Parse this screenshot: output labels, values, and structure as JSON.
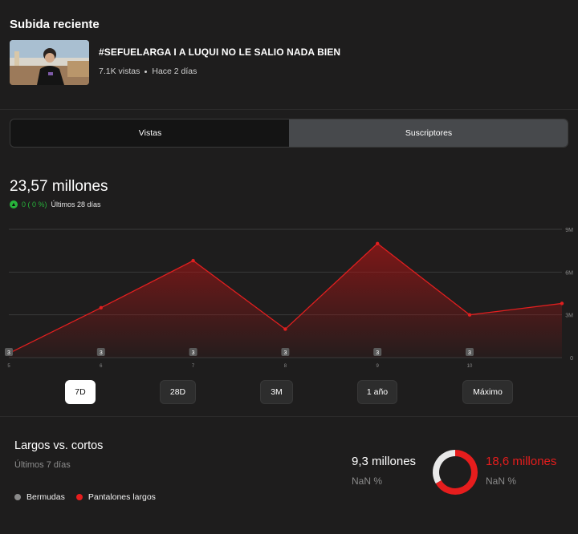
{
  "recent_upload": {
    "section_title": "Subida reciente",
    "video_title": "#SEFUELARGA I A LUQUI NO LE SALIO NADA BIEN",
    "views": "7.1K vistas",
    "age": "Hace 2 días"
  },
  "tabs": [
    {
      "label": "Vistas",
      "selected": false
    },
    {
      "label": "Suscriptores",
      "selected": true
    }
  ],
  "summary": {
    "total": "23,57 millones",
    "delta": "0 ( 0 %)",
    "period": "Últimos 28 días",
    "delta_color": "#27b33b"
  },
  "chart_data": {
    "type": "area",
    "x": [
      "5",
      "6",
      "7",
      "8",
      "9",
      "10",
      ""
    ],
    "x_tick_labels": [
      "5",
      "6",
      "7",
      "8",
      "9",
      "10"
    ],
    "values": [
      0.3,
      3.5,
      6.8,
      2.0,
      8.0,
      3.0,
      3.8
    ],
    "y_ticks": [
      "9M",
      "6M",
      "3M",
      "0"
    ],
    "ylim": [
      0,
      9
    ],
    "markers": [
      "3",
      "3",
      "3",
      "3",
      "3",
      "3"
    ],
    "line_color": "#e01f1f",
    "grid": true
  },
  "ranges": [
    {
      "label": "7D",
      "active": true
    },
    {
      "label": "28D",
      "active": false
    },
    {
      "label": "3M",
      "active": false
    },
    {
      "label": "1 año",
      "active": false
    },
    {
      "label": "Máximo",
      "active": false
    }
  ],
  "comparison": {
    "title": "Largos vs. cortos",
    "subtitle": "Últimos 7 días",
    "left_value": "9,3 millones",
    "left_pct": "NaN %",
    "right_value": "18,6 millones",
    "right_pct": "NaN %",
    "legend": [
      {
        "label": "Bermudas",
        "color": "#8a8a8a"
      },
      {
        "label": "Pantalones largos",
        "color": "#e61d1d"
      }
    ],
    "donut": {
      "left_share": 0.333,
      "right_share": 0.667,
      "left_color": "#e9e9e9",
      "right_color": "#e61d1d"
    }
  }
}
